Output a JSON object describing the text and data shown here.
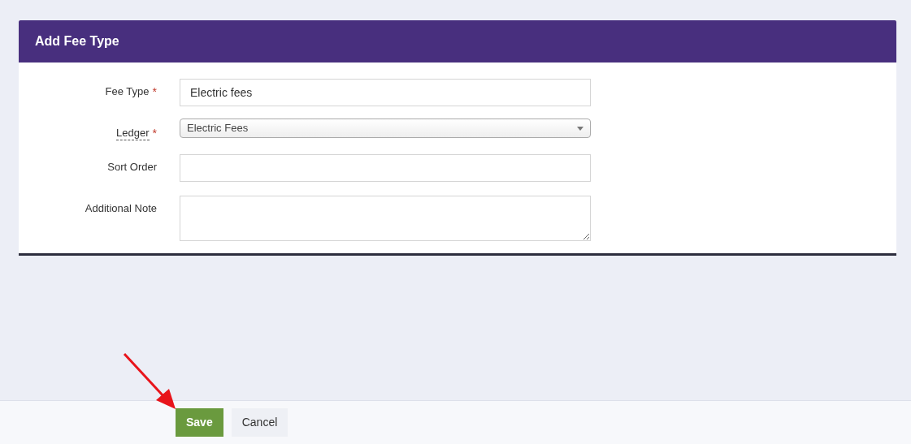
{
  "panel": {
    "title": "Add Fee Type"
  },
  "fields": [
    {
      "kind": "text",
      "label": "Fee Type",
      "required_mark": "*",
      "help": false,
      "value": "Electric fees"
    },
    {
      "kind": "select",
      "label": "Ledger",
      "required_mark": "*",
      "help": true,
      "value": "Electric Fees"
    },
    {
      "kind": "text",
      "label": "Sort Order",
      "help": false
    },
    {
      "kind": "textarea",
      "label": "Additional Note",
      "help": false
    }
  ],
  "buttons": [
    {
      "kind": "primary",
      "label": "Save"
    },
    {
      "kind": "secondary",
      "label": "Cancel"
    }
  ]
}
